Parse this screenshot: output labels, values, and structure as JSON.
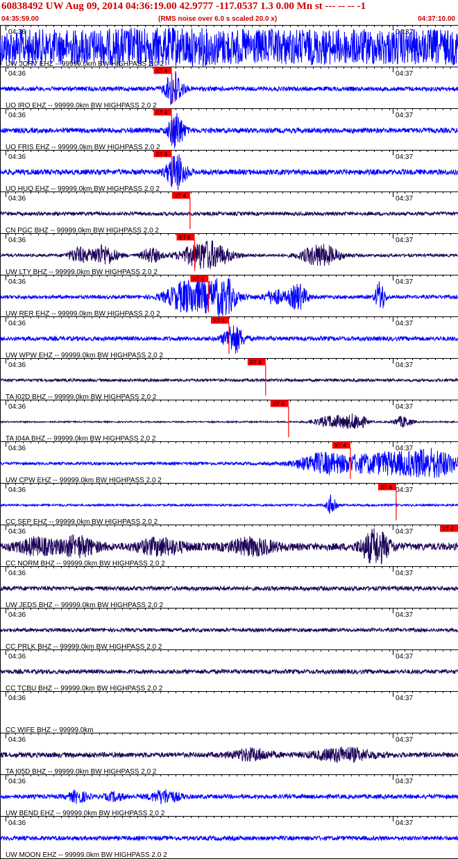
{
  "header": {
    "title": "60838492 UW Aug 09, 2014 04:36:19.00    42.9777 -117.0537  1.3 0.00 Mn st --- -- --  -1",
    "start_time": "04:35:59.00",
    "rms_note": "(RMS noise over 6.0 s scaled 20.0 x)",
    "end_time": "04:37:10.00"
  },
  "colors": {
    "trace_blue": "#0000ff",
    "trace_dark": "#1a0057",
    "pick_red": "#ff0000",
    "header_red": "#cc0000",
    "ink": "#000000"
  },
  "chart_data": {
    "type": "seismogram",
    "time_range": [
      "04:35:59.00",
      "04:37:10.00"
    ],
    "ticks": [
      "04:36",
      "04:37"
    ],
    "pick_label": "XT 4",
    "traces": [
      {
        "label": "UW JORV EHZ -- 99999.0km BW  HIGHPASS  2.0  2",
        "color": "blue",
        "amp": 1.0,
        "pick": 0.375,
        "bursts": [
          [
            0.35,
            0.95,
            0.06
          ]
        ],
        "pickLabelAbove": false
      },
      {
        "label": "UO IRO EHZ -- 99999.0km BW  HIGHPASS  2.0  2",
        "color": "blue",
        "amp": 0.12,
        "pick": 0.375,
        "bursts": [
          [
            0.38,
            1.0,
            0.018
          ]
        ],
        "pickLabelAbove": false
      },
      {
        "label": "UO FRIS EHZ -- 99999.0km BW  HIGHPASS  2.0  2",
        "color": "blue",
        "amp": 0.14,
        "pick": 0.375,
        "bursts": [
          [
            0.385,
            1.0,
            0.016
          ]
        ]
      },
      {
        "label": "UO HUQ EHZ -- 99999.0km BW  HIGHPASS  2.0  2",
        "color": "blue",
        "amp": 0.15,
        "pick": 0.375,
        "bursts": [
          [
            0.385,
            1.0,
            0.02
          ]
        ]
      },
      {
        "label": "CN PGC BHZ -- 99999.0km BW  HIGHPASS  2.0  2",
        "color": "dark",
        "amp": 0.1,
        "pick": 0.415,
        "bursts": []
      },
      {
        "label": "UW LTY BHZ -- 99999.0km BW  HIGHPASS  2.0  2",
        "color": "dark",
        "amp": 0.08,
        "pick": 0.425,
        "bursts": [
          [
            0.17,
            0.4,
            0.02
          ],
          [
            0.225,
            0.55,
            0.03
          ],
          [
            0.45,
            0.8,
            0.05
          ],
          [
            0.7,
            0.6,
            0.04
          ],
          [
            0.33,
            0.4,
            0.02
          ]
        ]
      },
      {
        "label": "UW RER EHZ -- 99999.0km BW  HIGHPASS  2.0  2",
        "color": "blue",
        "amp": 0.1,
        "pick": 0.455,
        "bursts": [
          [
            0.45,
            0.7,
            0.06
          ],
          [
            0.4,
            0.5,
            0.04
          ],
          [
            0.49,
            0.8,
            0.02
          ],
          [
            0.65,
            0.7,
            0.02
          ],
          [
            0.83,
            0.9,
            0.01
          ],
          [
            0.6,
            0.4,
            0.02
          ]
        ]
      },
      {
        "label": "UW WPW EHZ -- 99999.0km BW  HIGHPASS  2.0  2",
        "color": "blue",
        "amp": 0.12,
        "pick": 0.5,
        "bursts": [
          [
            0.51,
            0.8,
            0.02
          ]
        ]
      },
      {
        "label": "TA I02D BHZ -- 99999.0km BW  HIGHPASS  2.0  2",
        "color": "dark",
        "amp": 0.08,
        "pick": 0.58,
        "bursts": []
      },
      {
        "label": "TA I04A BHZ -- 99999.0km BW  HIGHPASS  2.0  2",
        "color": "dark",
        "amp": 0.04,
        "pick": 0.63,
        "bursts": [
          [
            0.73,
            0.35,
            0.04
          ],
          [
            0.78,
            0.4,
            0.02
          ],
          [
            0.88,
            0.3,
            0.02
          ]
        ]
      },
      {
        "label": "UW CPW EHZ -- 99999.0km BW  HIGHPASS  2.0  2",
        "color": "blue",
        "amp": 0.08,
        "pick": 0.765,
        "bursts": [
          [
            0.85,
            0.6,
            0.12
          ],
          [
            0.7,
            0.45,
            0.05
          ],
          [
            0.95,
            0.5,
            0.05
          ]
        ]
      },
      {
        "label": "CC SEP EHZ -- 99999.0km BW  HIGHPASS  2.0  2",
        "color": "blue",
        "amp": 0.06,
        "pick": 0.865,
        "bursts": [
          [
            0.725,
            0.6,
            0.01
          ]
        ]
      },
      {
        "label": "CC NORM BHZ -- 99999.0km BW  HIGHPASS  2.0  2",
        "color": "dark",
        "amp": 0.2,
        "pick": 1.04,
        "bursts": [
          [
            0.17,
            0.5,
            0.04
          ],
          [
            0.35,
            0.4,
            0.05
          ],
          [
            0.55,
            0.4,
            0.05
          ],
          [
            0.82,
            0.9,
            0.03
          ],
          [
            0.08,
            0.4,
            0.04
          ]
        ]
      },
      {
        "label": "UW JEDS BHZ -- 99999.0km BW  HIGHPASS  2.0  2",
        "color": "dark",
        "amp": 0.12,
        "pick": 1.1,
        "bursts": []
      },
      {
        "label": "CC PRLK BHZ -- 99999.0km BW  HIGHPASS  2.0  2",
        "color": "dark",
        "amp": 0.1,
        "pick": 1.1,
        "bursts": []
      },
      {
        "label": "CC TCBU BHZ -- 99999.0km BW  HIGHPASS  2.0  2",
        "color": "dark",
        "amp": 0.12,
        "pick": 1.1,
        "bursts": []
      },
      {
        "label": "CC WIFE BHZ -- 99999.0km",
        "color": "none",
        "amp": 0,
        "pick": 1.1,
        "bursts": []
      },
      {
        "label": "TA I05D BHZ -- 99999.0km BW  HIGHPASS  2.0  2",
        "color": "dark",
        "amp": 0.14,
        "pick": 1.1,
        "bursts": [
          [
            0.75,
            0.35,
            0.06
          ],
          [
            0.55,
            0.3,
            0.04
          ]
        ]
      },
      {
        "label": "UW BEND EHZ -- 99999.0km BW  HIGHPASS  2.0  2",
        "color": "blue",
        "amp": 0.12,
        "pick": 1.1,
        "bursts": [
          [
            0.17,
            0.3,
            0.02
          ],
          [
            0.36,
            0.35,
            0.03
          ],
          [
            0.25,
            0.2,
            0.02
          ]
        ]
      },
      {
        "label": "UW MOON EHZ -- 99999.0km BW  HIGHPASS  2.0  2",
        "color": "blue",
        "amp": 0.12,
        "pick": 1.1,
        "bursts": []
      }
    ]
  }
}
